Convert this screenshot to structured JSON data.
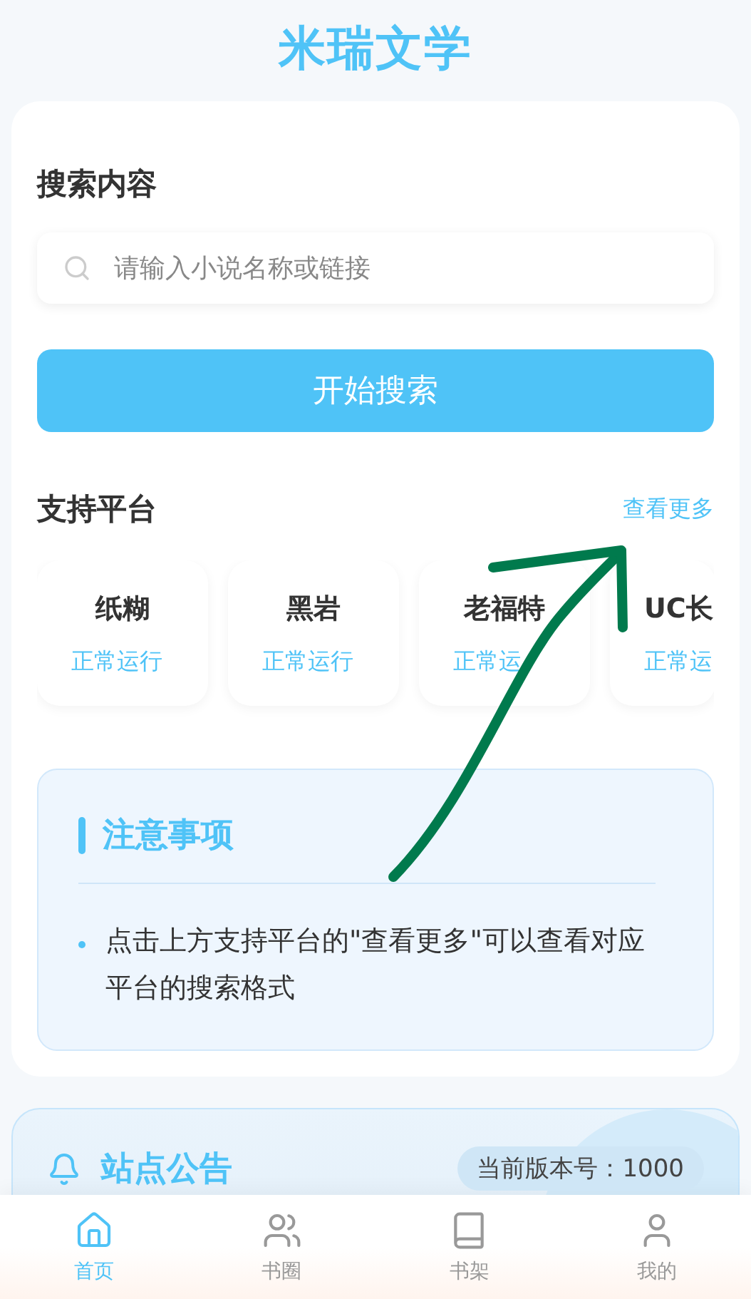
{
  "app_title": "米瑞文学",
  "search": {
    "heading": "搜索内容",
    "placeholder": "请输入小说名称或链接",
    "button": "开始搜索"
  },
  "platforms": {
    "heading": "支持平台",
    "more_link": "查看更多",
    "items": [
      {
        "name": "纸糊",
        "status": "正常运行",
        "cut": false
      },
      {
        "name": "黑岩",
        "status": "正常运行",
        "cut": false
      },
      {
        "name": "老福特",
        "status": "正常运",
        "cut": false
      },
      {
        "name": "UC长",
        "status": "正常运",
        "cut": true
      }
    ]
  },
  "notes": {
    "heading": "注意事项",
    "items": [
      "点击上方支持平台的\"查看更多\"可以查看对应平台的搜索格式"
    ]
  },
  "announcement": {
    "heading": "站点公告",
    "version": "当前版本号：1000"
  },
  "tab_bar": [
    {
      "label": "首页",
      "selected": true
    },
    {
      "label": "书圈",
      "selected": false
    },
    {
      "label": "书架",
      "selected": false
    },
    {
      "label": "我的",
      "selected": false
    }
  ]
}
